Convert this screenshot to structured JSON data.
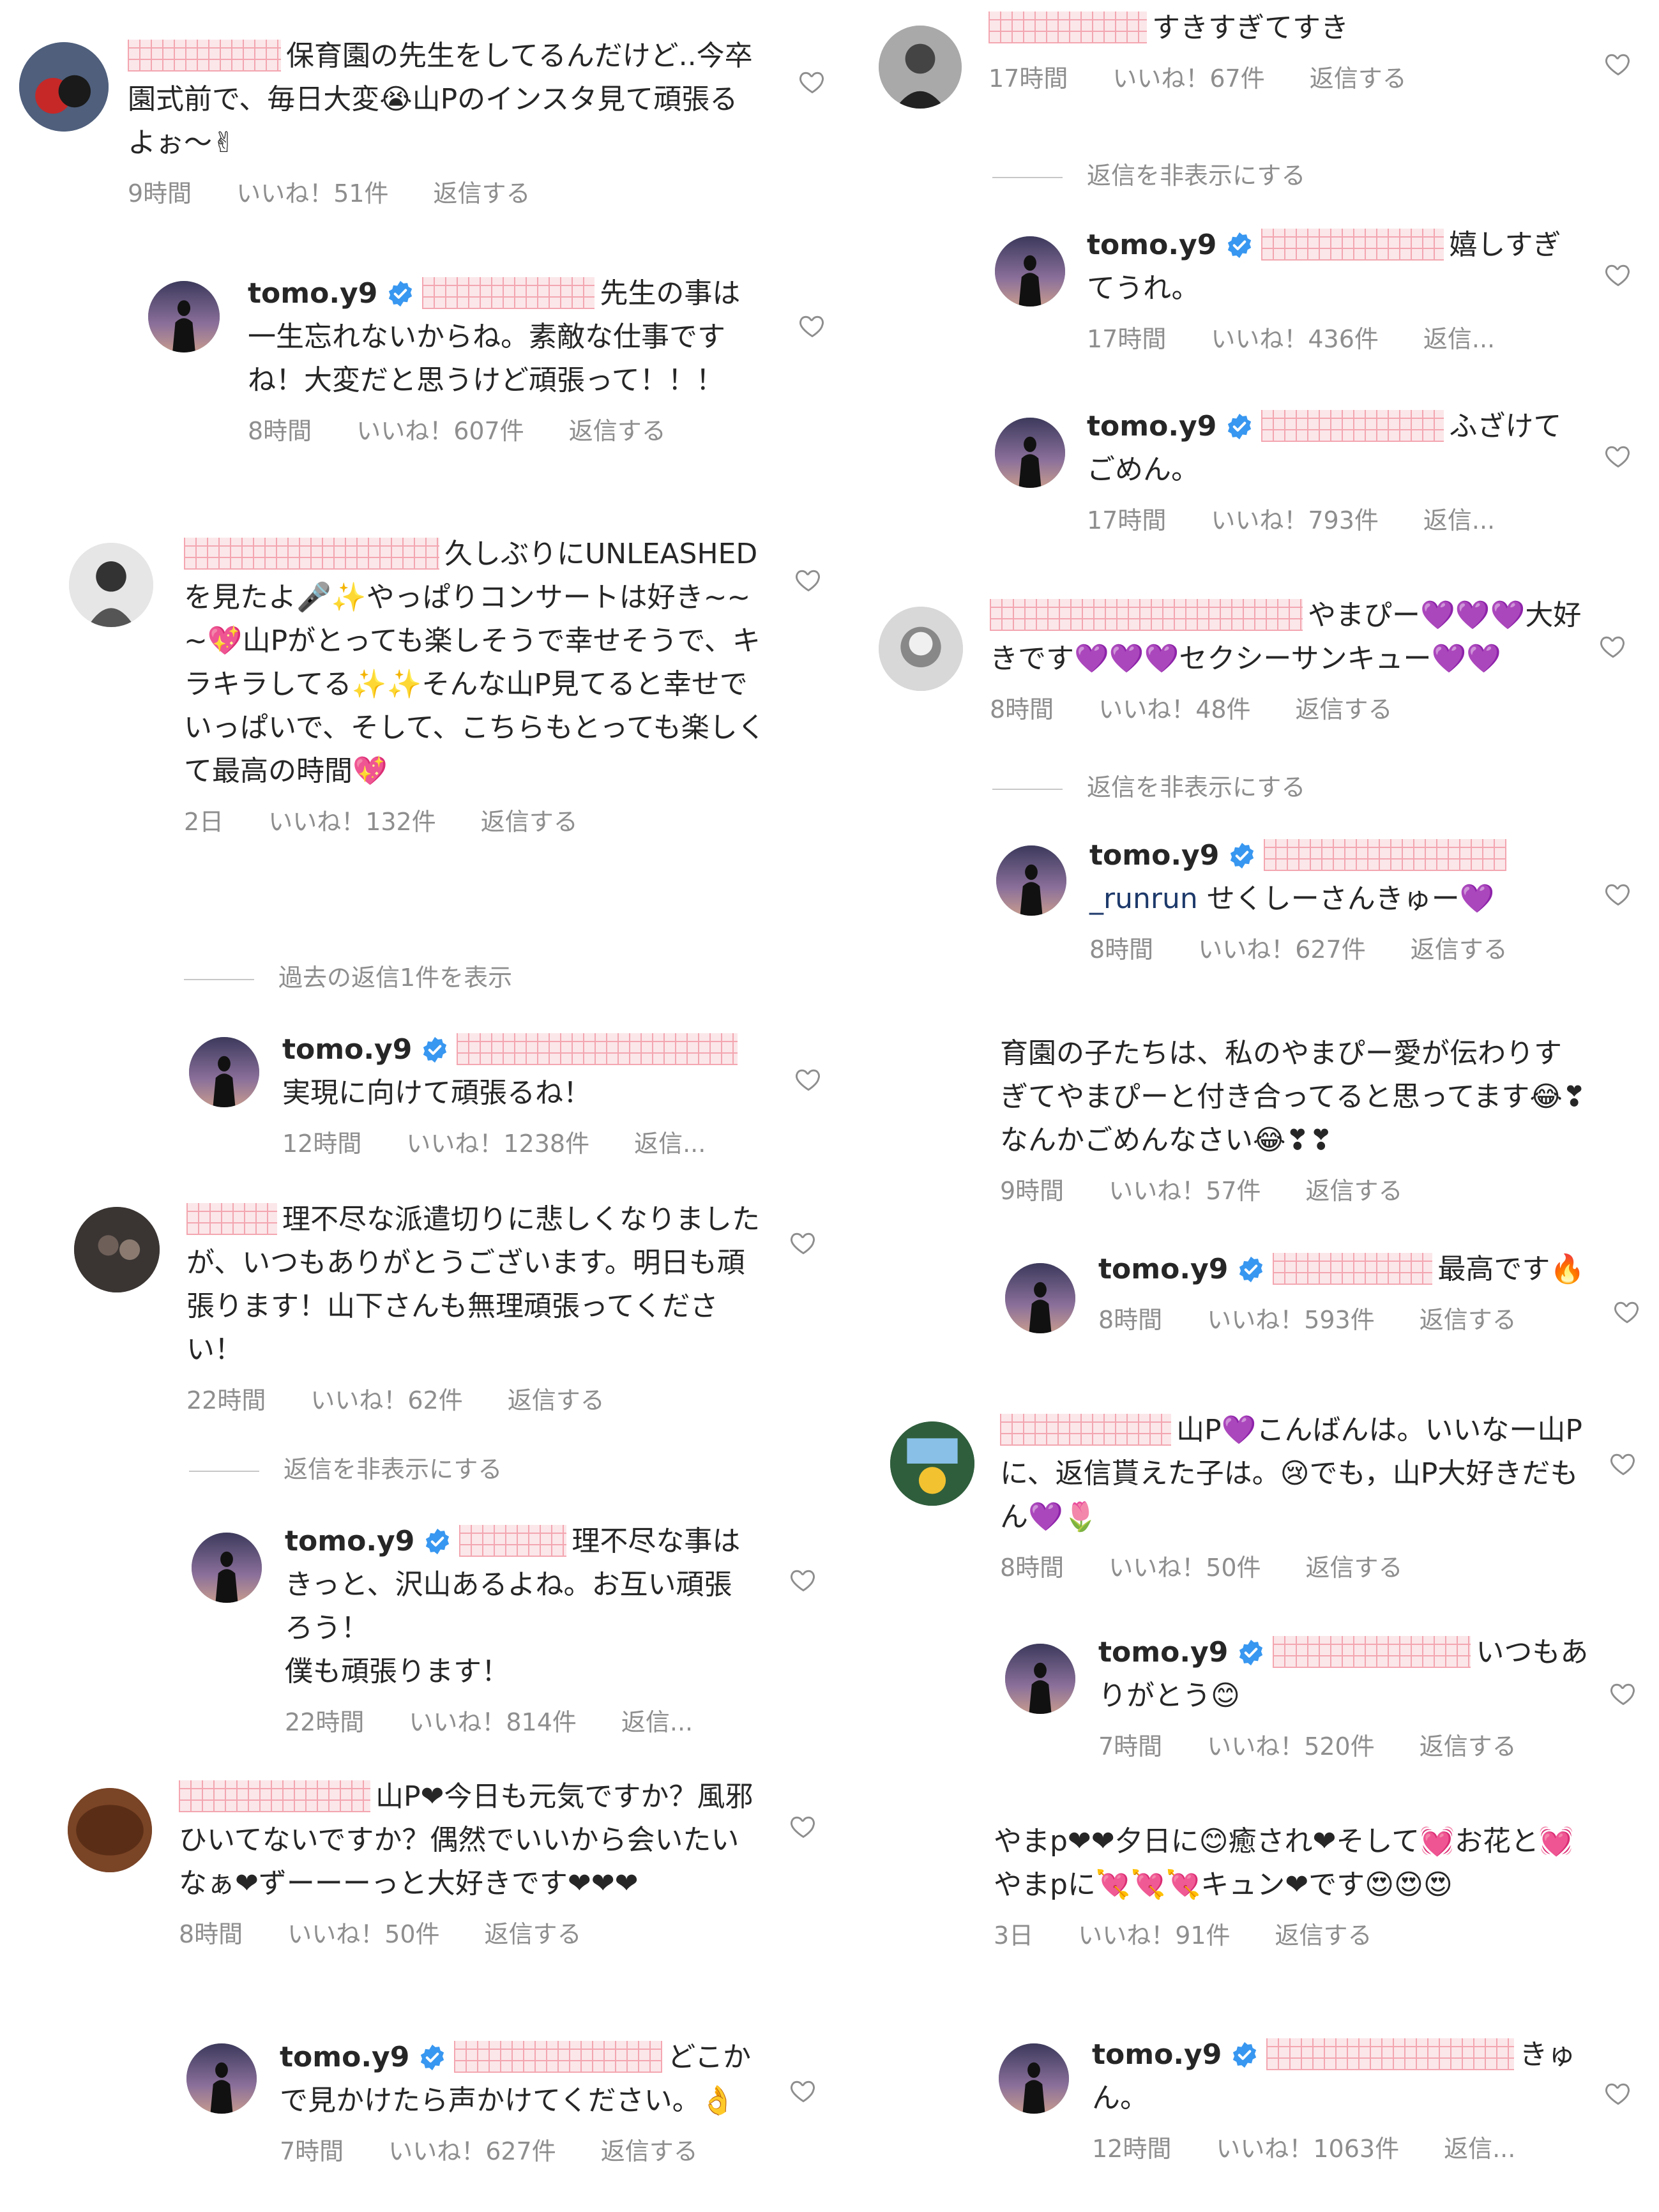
{
  "left": {
    "c1": {
      "text": "保育園の先生をしてるんだけど..今卒園式前で、毎日大変😭山Pのインスタ見て頑張るよぉ〜✌",
      "time": "9時間",
      "likes": "いいね！51件",
      "reply": "返信する"
    },
    "r1": {
      "user": "tomo.y9",
      "text": "先生の事は一生忘れないからね。素敵な仕事ですね！大変だと思うけど頑張って！！！",
      "time": "8時間",
      "likes": "いいね！607件",
      "reply": "返信する"
    },
    "c2": {
      "text": "久しぶりにUNLEASHEDを見たよ🎤✨やっぱりコンサートは好き~~~💖山Pがとっても楽しそうで幸せそうで、キラキラしてる✨✨そんな山P見てると幸せでいっぱいで、そして、こちらもとっても楽しくて最高の時間💖",
      "time": "2日",
      "likes": "いいね！132件",
      "reply": "返信する"
    },
    "toggle1": "過去の返信1件を表示",
    "r2": {
      "user": "tomo.y9",
      "text": "実現に向けて頑張るね！",
      "time": "12時間",
      "likes": "いいね！1238件",
      "reply": "返信..."
    },
    "c3": {
      "text": "理不尽な派遣切りに悲しくなりましたが、いつもありがとうございます。明日も頑張ります！山下さんも無理頑張ってください！",
      "time": "22時間",
      "likes": "いいね！62件",
      "reply": "返信する"
    },
    "toggle2": "返信を非表示にする",
    "r3": {
      "user": "tomo.y9",
      "text": "理不尽な事はきっと、沢山あるよね。お互い頑張ろう！",
      "text2": "僕も頑張ります！",
      "time": "22時間",
      "likes": "いいね！814件",
      "reply": "返信..."
    },
    "c4": {
      "text": "山P❤今日も元気ですか？風邪ひいてないですか？偶然でいいから会いたいなぁ❤ずーーーっと大好きです❤❤❤",
      "time": "8時間",
      "likes": "いいね！50件",
      "reply": "返信する"
    },
    "r4": {
      "user": "tomo.y9",
      "text": "どこかで見かけたら声かけてください。👌",
      "time": "7時間",
      "likes": "いいね！627件",
      "reply": "返信する"
    }
  },
  "right": {
    "c5": {
      "text": "すきすぎてすき",
      "time": "17時間",
      "likes": "いいね！67件",
      "reply": "返信する"
    },
    "toggle3": "返信を非表示にする",
    "r5": {
      "user": "tomo.y9",
      "text": "嬉しすぎてうれ。",
      "time": "17時間",
      "likes": "いいね！436件",
      "reply": "返信..."
    },
    "r6": {
      "user": "tomo.y9",
      "text": "ふざけてごめん。",
      "time": "17時間",
      "likes": "いいね！793件",
      "reply": "返信..."
    },
    "c6": {
      "text": "やまぴー💜💜💜大好きです💜💜💜セクシーサンキュー💜💜",
      "time": "8時間",
      "likes": "いいね！48件",
      "reply": "返信する"
    },
    "toggle4": "返信を非表示にする",
    "r7": {
      "user": "tomo.y9",
      "mention": "_runrun",
      "text": "せくしーさんきゅー💜",
      "time": "8時間",
      "likes": "いいね！627件",
      "reply": "返信する"
    },
    "c7": {
      "text": "育園の子たちは、私のやまぴー愛が伝わりすぎてやまぴーと付き合ってると思ってます😂❣なんかごめんなさい😂❣❣",
      "time": "9時間",
      "likes": "いいね！57件",
      "reply": "返信する"
    },
    "r8": {
      "user": "tomo.y9",
      "text": "最高です🔥",
      "time": "8時間",
      "likes": "いいね！593件",
      "reply": "返信する"
    },
    "c8": {
      "text": "山P💜こんばんは。いいなー山Pに、返信貰えた子は。😢でも，山P大好きだもん💜🌷",
      "time": "8時間",
      "likes": "いいね！50件",
      "reply": "返信する"
    },
    "r9": {
      "user": "tomo.y9",
      "text": "いつもありがとう😊",
      "time": "7時間",
      "likes": "いいね！520件",
      "reply": "返信する"
    },
    "c9": {
      "text": "やまp❤❤夕日に😊癒され❤そして💓お花と💓やまpに💘💘💘キュン❤です😍😍😍",
      "time": "3日",
      "likes": "いいね！91件",
      "reply": "返信する"
    },
    "r10": {
      "user": "tomo.y9",
      "text": "きゅん。",
      "time": "12時間",
      "likes": "いいね！1063件",
      "reply": "返信..."
    }
  }
}
